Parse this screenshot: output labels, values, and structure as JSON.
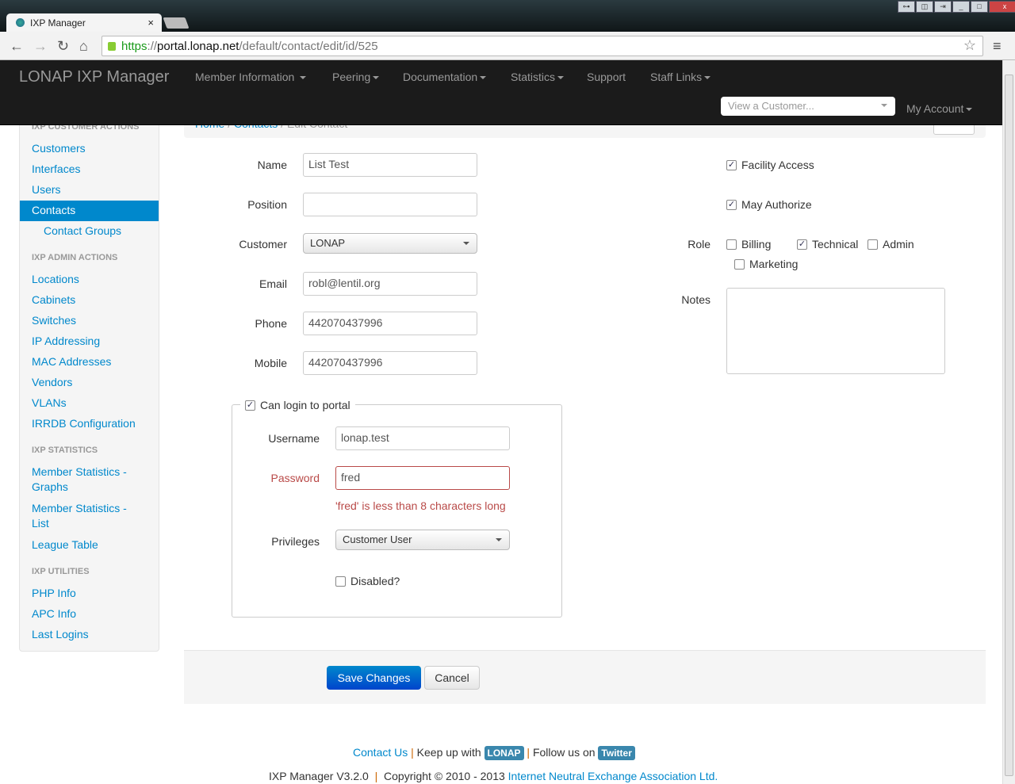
{
  "browser": {
    "tab_title": "IXP Manager",
    "url_scheme": "https",
    "url_sep": "://",
    "url_domain": "portal.lonap.net",
    "url_path": "/default/contact/edit/id/525"
  },
  "navbar": {
    "brand": "LONAP IXP Manager",
    "items": [
      "Member Information",
      "Peering",
      "Documentation",
      "Statistics",
      "Support",
      "Staff Links"
    ],
    "customer_select": "View a Customer...",
    "account": "My Account"
  },
  "breadcrumb": [
    "Home",
    "Contacts",
    "Edit Contact"
  ],
  "sidebar": {
    "sections": [
      {
        "header": "IXP Customer Actions",
        "items": [
          "Customers",
          "Interfaces",
          "Users",
          "Contacts",
          "Contact Groups"
        ]
      },
      {
        "header": "IXP Admin Actions",
        "items": [
          "Locations",
          "Cabinets",
          "Switches",
          "IP Addressing",
          "MAC Addresses",
          "Vendors",
          "VLANs",
          "IRRDB Configuration"
        ]
      },
      {
        "header": "IXP Statistics",
        "items": [
          "Member Statistics - Graphs",
          "Member Statistics - List",
          "League Table"
        ]
      },
      {
        "header": "IXP Utilities",
        "items": [
          "PHP Info",
          "APC Info",
          "Last Logins"
        ]
      }
    ],
    "active": "Contacts"
  },
  "form": {
    "name": {
      "label": "Name",
      "value": "List Test"
    },
    "position": {
      "label": "Position",
      "value": ""
    },
    "customer": {
      "label": "Customer",
      "value": "LONAP"
    },
    "email": {
      "label": "Email",
      "value": "robl@lentil.org"
    },
    "phone": {
      "label": "Phone",
      "value": "442070437996"
    },
    "mobile": {
      "label": "Mobile",
      "value": "442070437996"
    },
    "facility_access": {
      "label": "Facility Access",
      "checked": true
    },
    "may_authorize": {
      "label": "May Authorize",
      "checked": true
    },
    "role": {
      "label": "Role",
      "options": [
        {
          "label": "Billing",
          "checked": false
        },
        {
          "label": "Technical",
          "checked": true
        },
        {
          "label": "Admin",
          "checked": false
        },
        {
          "label": "Marketing",
          "checked": false
        }
      ]
    },
    "notes": {
      "label": "Notes",
      "value": ""
    },
    "login": {
      "label": "Can login to portal",
      "checked": true,
      "username": {
        "label": "Username",
        "value": "lonap.test"
      },
      "password": {
        "label": "Password",
        "value": "fred",
        "error": "'fred' is less than 8 characters long"
      },
      "privileges": {
        "label": "Privileges",
        "value": "Customer User"
      },
      "disabled": {
        "label": "Disabled?",
        "checked": false
      }
    },
    "save": "Save Changes",
    "cancel": "Cancel"
  },
  "footer": {
    "contact": "Contact Us",
    "sep": "|",
    "keep_up": "Keep up with",
    "lonap_badge": "LONAP",
    "follow": "Follow us on",
    "twitter_badge": "Twitter",
    "version": "IXP Manager V3.2.0",
    "copyright": "Copyright © 2010 - 2013",
    "org": "Internet Neutral Exchange Association Ltd."
  },
  "colors": {
    "link": "#0088cc",
    "error": "#b94a48",
    "navbar": "#1b1b1b",
    "badge": "#3a87ad"
  }
}
